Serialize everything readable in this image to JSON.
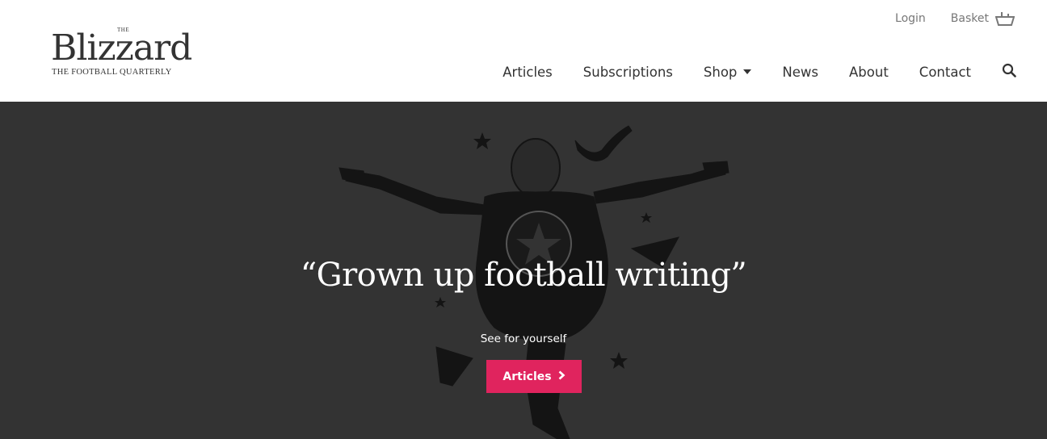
{
  "brand": {
    "the": "THE",
    "name": "Blizzard",
    "tagline": "THE FOOTBALL QUARTERLY"
  },
  "utility": {
    "login": "Login",
    "basket": "Basket"
  },
  "nav": {
    "items": [
      "Articles",
      "Subscriptions",
      "Shop",
      "News",
      "About",
      "Contact"
    ]
  },
  "hero": {
    "headline": "“Grown up football writing”",
    "subtext": "See for yourself",
    "cta_label": "Articles",
    "cta_color": "#e0245e",
    "background": "#333333"
  },
  "icons": {
    "basket": "basket-icon",
    "search": "search-icon",
    "shop_caret": "caret-down-icon",
    "cta_chevron": "chevron-right-icon"
  }
}
